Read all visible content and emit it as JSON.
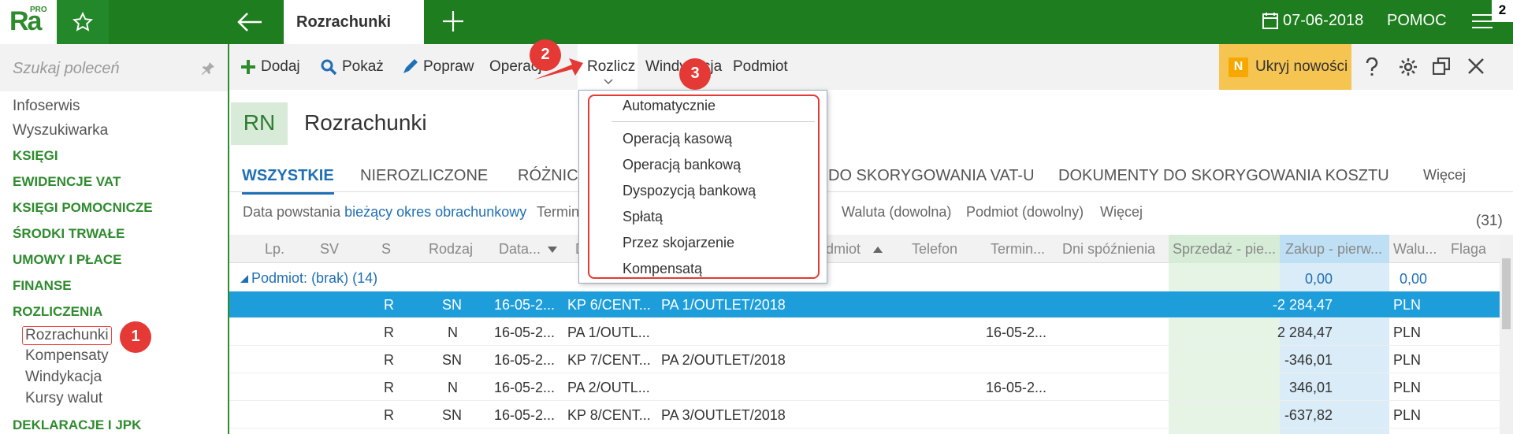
{
  "topbar": {
    "logo": "Ra",
    "logo_sup": "PRO",
    "active_tab": "Rozrachunki",
    "date": "07-06-2018",
    "help": "POMOC",
    "badge": "2"
  },
  "sidebar": {
    "search_placeholder": "Szukaj poleceń",
    "items": [
      "Infoserwis",
      "Wyszukiwarka"
    ],
    "categories": [
      "KSIĘGI",
      "EWIDENCJE VAT",
      "KSIĘGI POMOCNICZE",
      "ŚRODKI TRWAŁE",
      "UMOWY I PŁACE",
      "FINANSE",
      "ROZLICZENIA"
    ],
    "sub_items": [
      "Rozrachunki",
      "Kompensaty",
      "Windykacja",
      "Kursy walut"
    ],
    "last_category": "DEKLARACJE I JPK"
  },
  "toolbar": {
    "dodaj": "Dodaj",
    "pokaz": "Pokaż",
    "popraw": "Popraw",
    "operacje": "Operacje",
    "rozlicz": "Rozlicz",
    "windykacja": "Windykacja",
    "podmiot": "Podmiot",
    "ukryj": "Ukryj nowości",
    "n": "N"
  },
  "page": {
    "badge": "RN",
    "title": "Rozrachunki"
  },
  "tabs": {
    "t1": "WSZYSTKIE",
    "t2": "NIEROZLICZONE",
    "t3": "RÓŻNICE",
    "t4": "DO SKORYGOWANIA VAT-U",
    "t5": "DOKUMENTY DO SKORYGOWANIA KOSZTU",
    "more": "Więcej"
  },
  "filters": {
    "data_label": "Data powstania",
    "data_value": "bieżący okres obrachunkowy",
    "termin": "Termin",
    "waluta": "Waluta (dowolna)",
    "podmiot": "Podmiot (dowolny)",
    "wiecej": "Więcej",
    "count": "(31)"
  },
  "columns": {
    "lp": "Lp.",
    "sv": "SV",
    "s": "S",
    "rodzaj": "Rodzaj",
    "data": "Data...",
    "d": "D",
    "podmiot": "odmiot",
    "telefon": "Telefon",
    "termin": "Termin...",
    "dni": "Dni spóźnienia",
    "sprzedaz": "Sprzedaż - pie...",
    "zakup": "Zakup - pierw...",
    "waluta": "Walu...",
    "flaga": "Flaga"
  },
  "group": {
    "label": "Podmiot:",
    "value": "(brak)",
    "count": "(14)",
    "sum_sprz": "0,00",
    "sum_zak": "0,00"
  },
  "rows": [
    {
      "s": "R",
      "rodzaj": "SN",
      "data": "16-05-2...",
      "dok": "KP 6/CENT...",
      "podmiot": "PA 1/OUTLET/2018",
      "termin": "",
      "sprz": "-2 284,47",
      "waluta": "PLN"
    },
    {
      "s": "R",
      "rodzaj": "N",
      "data": "16-05-2...",
      "dok": "PA 1/OUTL...",
      "podmiot": "",
      "termin": "16-05-2...",
      "sprz": "2 284,47",
      "waluta": "PLN"
    },
    {
      "s": "R",
      "rodzaj": "SN",
      "data": "16-05-2...",
      "dok": "KP 7/CENT...",
      "podmiot": "PA 2/OUTLET/2018",
      "termin": "",
      "sprz": "-346,01",
      "waluta": "PLN"
    },
    {
      "s": "R",
      "rodzaj": "N",
      "data": "16-05-2...",
      "dok": "PA 2/OUTL...",
      "podmiot": "",
      "termin": "16-05-2...",
      "sprz": "346,01",
      "waluta": "PLN"
    },
    {
      "s": "R",
      "rodzaj": "SN",
      "data": "16-05-2...",
      "dok": "KP 8/CENT...",
      "podmiot": "PA 3/OUTLET/2018",
      "termin": "",
      "sprz": "-637,82",
      "waluta": "PLN"
    }
  ],
  "dropdown": {
    "items": [
      "Automatycznie",
      "Operacją kasową",
      "Operacją bankową",
      "Dyspozycją bankową",
      "Spłatą",
      "Przez skojarzenie",
      "Kompensatą"
    ]
  },
  "markers": [
    "1",
    "2",
    "3"
  ],
  "colors": {
    "brand_green": "#1e7d1e",
    "accent_blue": "#1f6fb5",
    "selection": "#1e9ddb",
    "marker_red": "#e53935"
  }
}
